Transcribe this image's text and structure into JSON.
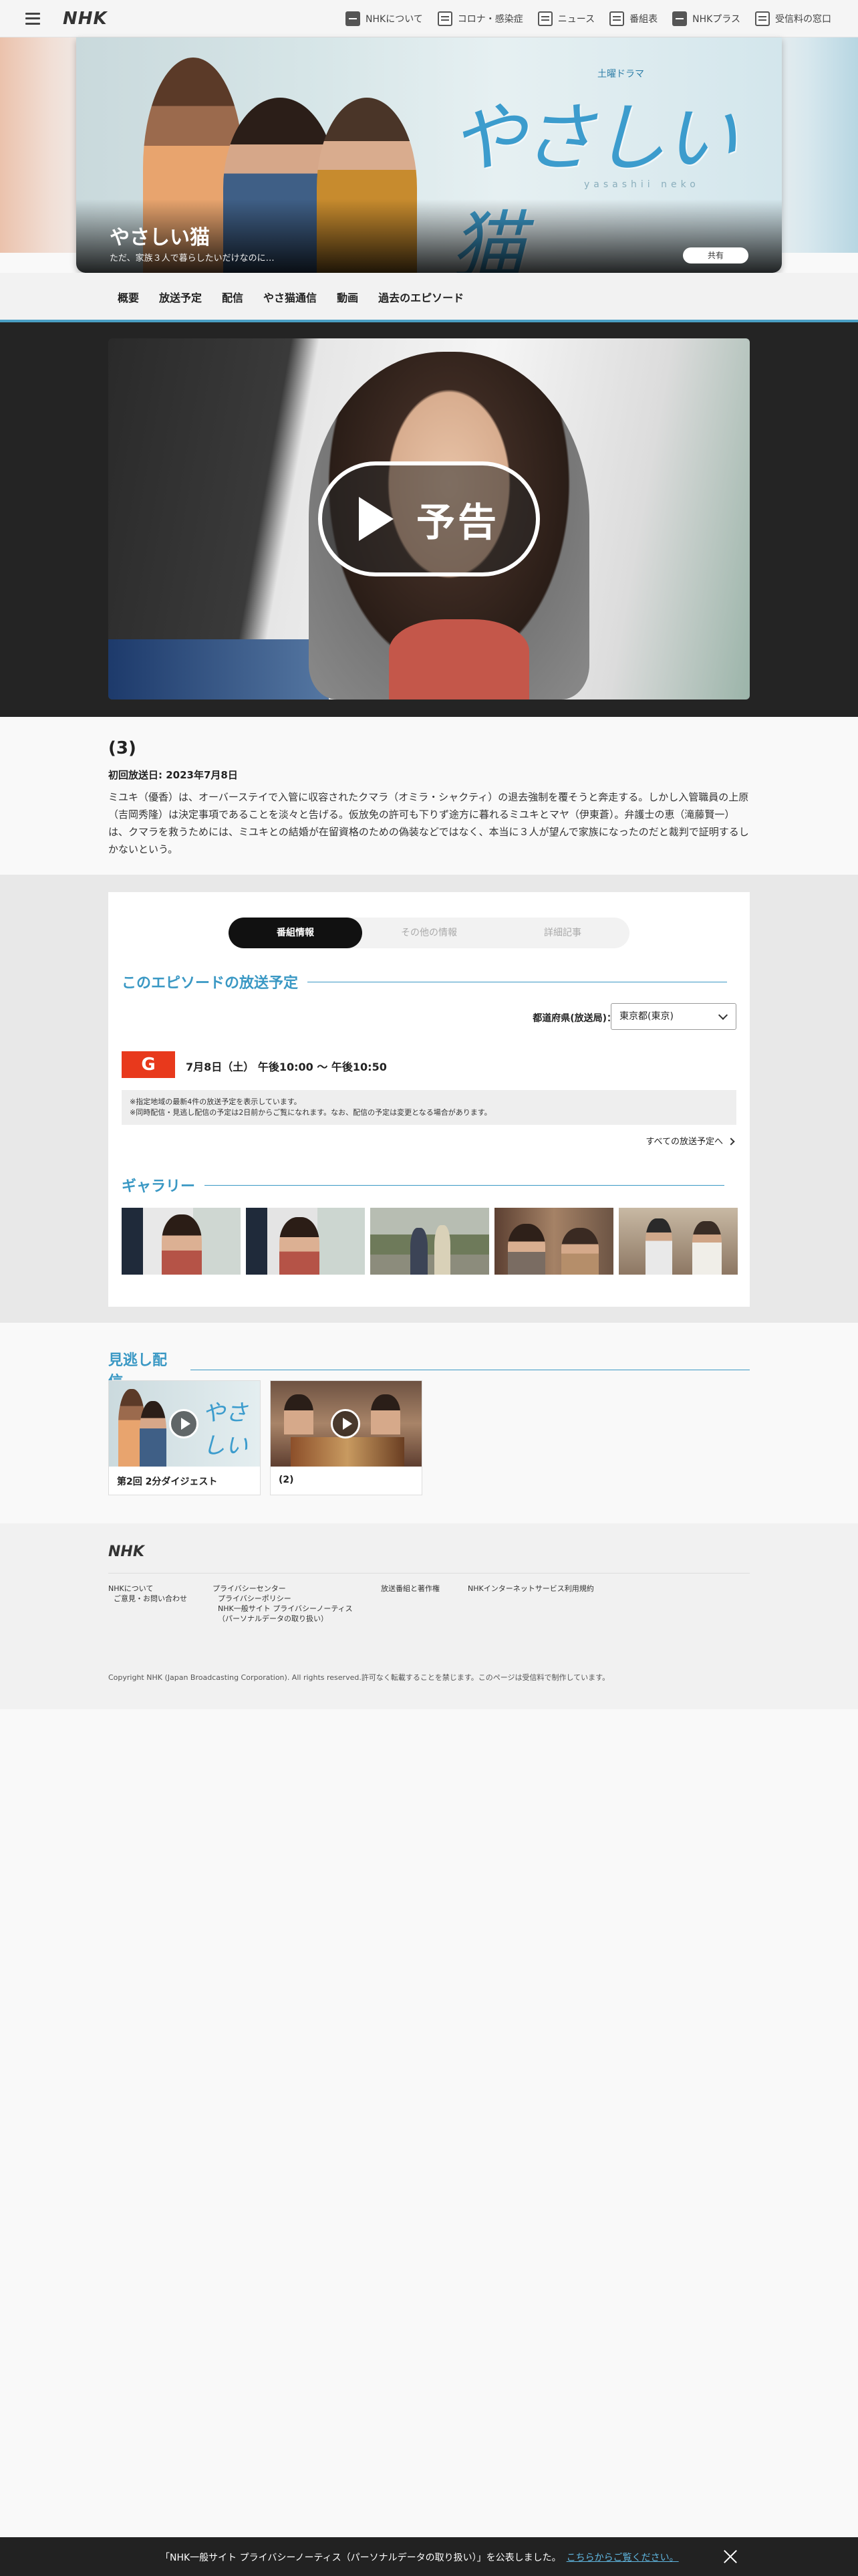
{
  "header": {
    "logo": "NHK",
    "nav": [
      {
        "label": "NHKについて",
        "icon": "nhk-about-icon"
      },
      {
        "label": "コロナ・感染症",
        "icon": "corona-icon"
      },
      {
        "label": "ニュース",
        "icon": "news-icon"
      },
      {
        "label": "番組表",
        "icon": "program-guide-icon"
      },
      {
        "label": "NHKプラス",
        "icon": "nhk-plus-icon"
      },
      {
        "label": "受信料の窓口",
        "icon": "fee-icon"
      }
    ]
  },
  "hero": {
    "drama_label": "土曜ドラマ",
    "logo_text": "やさしい猫",
    "logo_roman": "yasashii neko",
    "title": "やさしい猫",
    "subtitle": "ただ、家族３人で暮らしたいだけなのに…",
    "share_label": "共有"
  },
  "section_nav": [
    "概要",
    "放送予定",
    "配信",
    "やさ猫通信",
    "動画",
    "過去のエピソード"
  ],
  "video": {
    "label": "予告"
  },
  "episode": {
    "number": "(3)",
    "first_air": "初回放送日: 2023年7月8日",
    "description": "ミユキ（優香）は、オーバーステイで入管に収容されたクマラ（オミラ・シャクティ）の退去強制を覆そうと奔走する。しかし入管職員の上原（吉岡秀隆）は決定事項であることを淡々と告げる。仮放免の許可も下りず途方に暮れるミユキとマヤ（伊東蒼）。弁護士の恵（滝藤賢一）は、クマラを救うためには、ミユキとの結婚が在留資格のための偽装などではなく、本当に３人が望んで家族になったのだと裁判で証明するしかないという。"
  },
  "panel": {
    "tabs": [
      "番組情報",
      "その他の情報",
      "詳細記事"
    ],
    "schedule_title": "このエピソードの放送予定",
    "pref_label": "都道府県(放送局)：",
    "pref_value": "東京都(東京)",
    "channel_badge": "G",
    "airtime": "7月8日（土）  午後10:00 〜 午後10:50",
    "note1": "※指定地域の最新4件の放送予定を表示しています。",
    "note2": "※同時配信・見逃し配信の予定は2日前からご覧になれます。なお、配信の予定は変更となる場合があります。",
    "all_link": "すべての放送予定へ",
    "gallery_title": "ギャラリー"
  },
  "missed": {
    "title": "見逃し配信",
    "cards": [
      {
        "label": "第2回 2分ダイジェスト"
      },
      {
        "label": "(2)"
      }
    ]
  },
  "footer": {
    "logo": "NHK",
    "col1": [
      "NHKについて",
      "ご意見・お問い合わせ"
    ],
    "col2": [
      "プライバシーセンター",
      "プライバシーポリシー",
      "NHK一般サイト プライバシーノーティス",
      "（パーソナルデータの取り扱い）"
    ],
    "col3": [
      "放送番組と著作権"
    ],
    "col4": [
      "NHKインターネットサービス利用規約"
    ],
    "copyright": "Copyright NHK (Japan Broadcasting Corporation). All rights reserved.許可なく転載することを禁じます。このページは受信料で制作しています。"
  },
  "banner": {
    "text": "「NHK一般サイト プライバシーノーティス（パーソナルデータの取り扱い）」を公表しました。",
    "link": "こちらからご覧ください。"
  }
}
